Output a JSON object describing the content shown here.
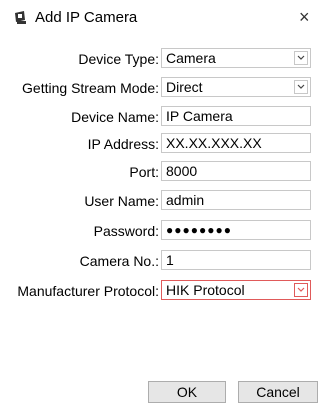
{
  "dialog": {
    "title": "Add IP Camera",
    "close_glyph": "×",
    "icon": "camera-app-icon"
  },
  "form": {
    "fields": [
      {
        "label": "Device Type:",
        "value": "Camera",
        "type": "select"
      },
      {
        "label": "Getting Stream Mode:",
        "value": "Direct",
        "type": "select"
      },
      {
        "label": "Device Name:",
        "value": "IP Camera",
        "type": "text"
      },
      {
        "label": "IP Address:",
        "value": "XX.XX.XXX.XX",
        "type": "text"
      },
      {
        "label": "Port:",
        "value": "8000",
        "type": "text"
      },
      {
        "label": "User Name:",
        "value": "admin",
        "type": "text"
      },
      {
        "label": "Password:",
        "value": "●●●●●●●●",
        "type": "password"
      },
      {
        "label": "Camera No.:",
        "value": "1",
        "type": "text"
      },
      {
        "label": "Manufacturer Protocol:",
        "value": "HIK Protocol",
        "type": "select"
      }
    ]
  },
  "buttons": {
    "ok_label": "OK",
    "cancel_label": "Cancel"
  },
  "colors": {
    "focus_border": "#e05a5a",
    "field_border": "#c8c8c8",
    "button_bg": "#e6e6e6"
  }
}
